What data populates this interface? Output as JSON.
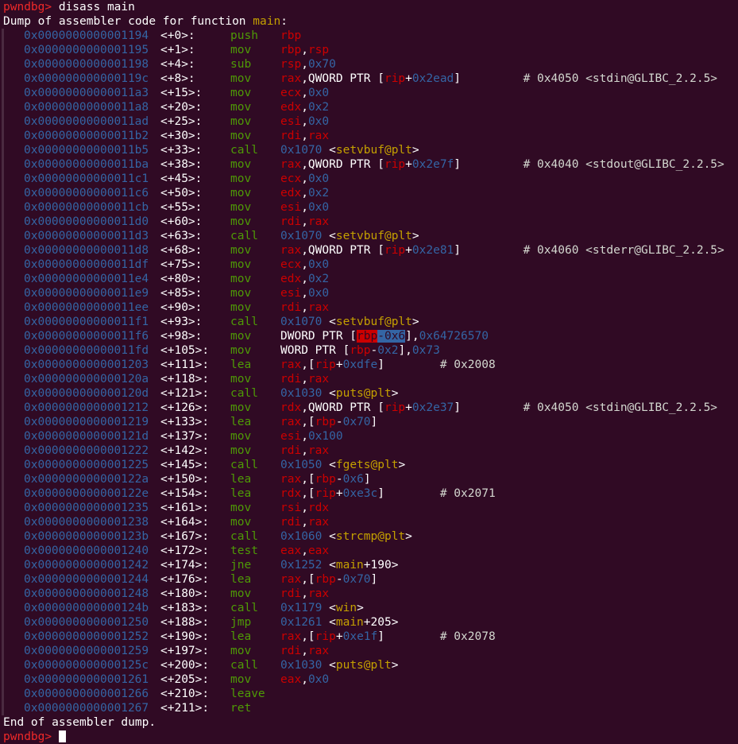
{
  "terminal": {
    "prompt": "pwndbg>",
    "command": " disass main",
    "header_prefix": "Dump of assembler code for function ",
    "function_name": "main",
    "header_suffix": ":",
    "footer": "End of assembler dump.",
    "next_prompt": "pwndbg>"
  },
  "instructions": [
    {
      "addr": "0x0000000000001194",
      "off": "<+0>:",
      "mn": "push",
      "ops": [
        [
          "reg",
          "rbp"
        ]
      ]
    },
    {
      "addr": "0x0000000000001195",
      "off": "<+1>:",
      "mn": "mov",
      "ops": [
        [
          "reg",
          "rbp"
        ],
        [
          "w",
          ","
        ],
        [
          "reg",
          "rsp"
        ]
      ]
    },
    {
      "addr": "0x0000000000001198",
      "off": "<+4>:",
      "mn": "sub",
      "ops": [
        [
          "reg",
          "rsp"
        ],
        [
          "w",
          ","
        ],
        [
          "num",
          "0x70"
        ]
      ]
    },
    {
      "addr": "0x000000000000119c",
      "off": "<+8>:",
      "mn": "mov",
      "ops": [
        [
          "reg",
          "rax"
        ],
        [
          "w",
          ",QWORD PTR ["
        ],
        [
          "reg",
          "rip"
        ],
        [
          "w",
          "+"
        ],
        [
          "num",
          "0x2ead"
        ],
        [
          "w",
          "]"
        ],
        [
          "cmt",
          "         # 0x4050 <stdin@GLIBC_2.2.5>"
        ]
      ]
    },
    {
      "addr": "0x00000000000011a3",
      "off": "<+15>:",
      "mn": "mov",
      "ops": [
        [
          "reg",
          "ecx"
        ],
        [
          "w",
          ","
        ],
        [
          "num",
          "0x0"
        ]
      ]
    },
    {
      "addr": "0x00000000000011a8",
      "off": "<+20>:",
      "mn": "mov",
      "ops": [
        [
          "reg",
          "edx"
        ],
        [
          "w",
          ","
        ],
        [
          "num",
          "0x2"
        ]
      ]
    },
    {
      "addr": "0x00000000000011ad",
      "off": "<+25>:",
      "mn": "mov",
      "ops": [
        [
          "reg",
          "esi"
        ],
        [
          "w",
          ","
        ],
        [
          "num",
          "0x0"
        ]
      ]
    },
    {
      "addr": "0x00000000000011b2",
      "off": "<+30>:",
      "mn": "mov",
      "ops": [
        [
          "reg",
          "rdi"
        ],
        [
          "w",
          ","
        ],
        [
          "reg",
          "rax"
        ]
      ]
    },
    {
      "addr": "0x00000000000011b5",
      "off": "<+33>:",
      "mn": "call",
      "ops": [
        [
          "num",
          "0x1070"
        ],
        [
          "w",
          " <"
        ],
        [
          "sym",
          "setvbuf@plt"
        ],
        [
          "w",
          ">"
        ]
      ]
    },
    {
      "addr": "0x00000000000011ba",
      "off": "<+38>:",
      "mn": "mov",
      "ops": [
        [
          "reg",
          "rax"
        ],
        [
          "w",
          ",QWORD PTR ["
        ],
        [
          "reg",
          "rip"
        ],
        [
          "w",
          "+"
        ],
        [
          "num",
          "0x2e7f"
        ],
        [
          "w",
          "]"
        ],
        [
          "cmt",
          "         # 0x4040 <stdout@GLIBC_2.2.5>"
        ]
      ]
    },
    {
      "addr": "0x00000000000011c1",
      "off": "<+45>:",
      "mn": "mov",
      "ops": [
        [
          "reg",
          "ecx"
        ],
        [
          "w",
          ","
        ],
        [
          "num",
          "0x0"
        ]
      ]
    },
    {
      "addr": "0x00000000000011c6",
      "off": "<+50>:",
      "mn": "mov",
      "ops": [
        [
          "reg",
          "edx"
        ],
        [
          "w",
          ","
        ],
        [
          "num",
          "0x2"
        ]
      ]
    },
    {
      "addr": "0x00000000000011cb",
      "off": "<+55>:",
      "mn": "mov",
      "ops": [
        [
          "reg",
          "esi"
        ],
        [
          "w",
          ","
        ],
        [
          "num",
          "0x0"
        ]
      ]
    },
    {
      "addr": "0x00000000000011d0",
      "off": "<+60>:",
      "mn": "mov",
      "ops": [
        [
          "reg",
          "rdi"
        ],
        [
          "w",
          ","
        ],
        [
          "reg",
          "rax"
        ]
      ]
    },
    {
      "addr": "0x00000000000011d3",
      "off": "<+63>:",
      "mn": "call",
      "ops": [
        [
          "num",
          "0x1070"
        ],
        [
          "w",
          " <"
        ],
        [
          "sym",
          "setvbuf@plt"
        ],
        [
          "w",
          ">"
        ]
      ]
    },
    {
      "addr": "0x00000000000011d8",
      "off": "<+68>:",
      "mn": "mov",
      "ops": [
        [
          "reg",
          "rax"
        ],
        [
          "w",
          ",QWORD PTR ["
        ],
        [
          "reg",
          "rip"
        ],
        [
          "w",
          "+"
        ],
        [
          "num",
          "0x2e81"
        ],
        [
          "w",
          "]"
        ],
        [
          "cmt",
          "         # 0x4060 <stderr@GLIBC_2.2.5>"
        ]
      ]
    },
    {
      "addr": "0x00000000000011df",
      "off": "<+75>:",
      "mn": "mov",
      "ops": [
        [
          "reg",
          "ecx"
        ],
        [
          "w",
          ","
        ],
        [
          "num",
          "0x0"
        ]
      ]
    },
    {
      "addr": "0x00000000000011e4",
      "off": "<+80>:",
      "mn": "mov",
      "ops": [
        [
          "reg",
          "edx"
        ],
        [
          "w",
          ","
        ],
        [
          "num",
          "0x2"
        ]
      ]
    },
    {
      "addr": "0x00000000000011e9",
      "off": "<+85>:",
      "mn": "mov",
      "ops": [
        [
          "reg",
          "esi"
        ],
        [
          "w",
          ","
        ],
        [
          "num",
          "0x0"
        ]
      ]
    },
    {
      "addr": "0x00000000000011ee",
      "off": "<+90>:",
      "mn": "mov",
      "ops": [
        [
          "reg",
          "rdi"
        ],
        [
          "w",
          ","
        ],
        [
          "reg",
          "rax"
        ]
      ]
    },
    {
      "addr": "0x00000000000011f1",
      "off": "<+93>:",
      "mn": "call",
      "ops": [
        [
          "num",
          "0x1070"
        ],
        [
          "w",
          " <"
        ],
        [
          "sym",
          "setvbuf@plt"
        ],
        [
          "w",
          ">"
        ]
      ]
    },
    {
      "addr": "0x00000000000011f6",
      "off": "<+98>:",
      "mn": "mov",
      "ops": [
        [
          "w",
          "DWORD PTR ["
        ],
        [
          "hlr",
          "rbp"
        ],
        [
          "hlb",
          "-0x6"
        ],
        [
          "w",
          "],"
        ],
        [
          "num",
          "0x64726570"
        ]
      ]
    },
    {
      "addr": "0x00000000000011fd",
      "off": "<+105>:",
      "mn": "mov",
      "ops": [
        [
          "w",
          "WORD PTR ["
        ],
        [
          "reg",
          "rbp"
        ],
        [
          "w",
          "-"
        ],
        [
          "num",
          "0x2"
        ],
        [
          "w",
          "],"
        ],
        [
          "num",
          "0x73"
        ]
      ]
    },
    {
      "addr": "0x0000000000001203",
      "off": "<+111>:",
      "mn": "lea",
      "ops": [
        [
          "reg",
          "rax"
        ],
        [
          "w",
          ",["
        ],
        [
          "reg",
          "rip"
        ],
        [
          "w",
          "+"
        ],
        [
          "num",
          "0xdfe"
        ],
        [
          "w",
          "]"
        ],
        [
          "cmt",
          "        # 0x2008"
        ]
      ]
    },
    {
      "addr": "0x000000000000120a",
      "off": "<+118>:",
      "mn": "mov",
      "ops": [
        [
          "reg",
          "rdi"
        ],
        [
          "w",
          ","
        ],
        [
          "reg",
          "rax"
        ]
      ]
    },
    {
      "addr": "0x000000000000120d",
      "off": "<+121>:",
      "mn": "call",
      "ops": [
        [
          "num",
          "0x1030"
        ],
        [
          "w",
          " <"
        ],
        [
          "sym",
          "puts@plt"
        ],
        [
          "w",
          ">"
        ]
      ]
    },
    {
      "addr": "0x0000000000001212",
      "off": "<+126>:",
      "mn": "mov",
      "ops": [
        [
          "reg",
          "rdx"
        ],
        [
          "w",
          ",QWORD PTR ["
        ],
        [
          "reg",
          "rip"
        ],
        [
          "w",
          "+"
        ],
        [
          "num",
          "0x2e37"
        ],
        [
          "w",
          "]"
        ],
        [
          "cmt",
          "         # 0x4050 <stdin@GLIBC_2.2.5>"
        ]
      ]
    },
    {
      "addr": "0x0000000000001219",
      "off": "<+133>:",
      "mn": "lea",
      "ops": [
        [
          "reg",
          "rax"
        ],
        [
          "w",
          ",["
        ],
        [
          "reg",
          "rbp"
        ],
        [
          "w",
          "-"
        ],
        [
          "num",
          "0x70"
        ],
        [
          "w",
          "]"
        ]
      ]
    },
    {
      "addr": "0x000000000000121d",
      "off": "<+137>:",
      "mn": "mov",
      "ops": [
        [
          "reg",
          "esi"
        ],
        [
          "w",
          ","
        ],
        [
          "num",
          "0x100"
        ]
      ]
    },
    {
      "addr": "0x0000000000001222",
      "off": "<+142>:",
      "mn": "mov",
      "ops": [
        [
          "reg",
          "rdi"
        ],
        [
          "w",
          ","
        ],
        [
          "reg",
          "rax"
        ]
      ]
    },
    {
      "addr": "0x0000000000001225",
      "off": "<+145>:",
      "mn": "call",
      "ops": [
        [
          "num",
          "0x1050"
        ],
        [
          "w",
          " <"
        ],
        [
          "sym",
          "fgets@plt"
        ],
        [
          "w",
          ">"
        ]
      ]
    },
    {
      "addr": "0x000000000000122a",
      "off": "<+150>:",
      "mn": "lea",
      "ops": [
        [
          "reg",
          "rax"
        ],
        [
          "w",
          ",["
        ],
        [
          "reg",
          "rbp"
        ],
        [
          "w",
          "-"
        ],
        [
          "num",
          "0x6"
        ],
        [
          "w",
          "]"
        ]
      ]
    },
    {
      "addr": "0x000000000000122e",
      "off": "<+154>:",
      "mn": "lea",
      "ops": [
        [
          "reg",
          "rdx"
        ],
        [
          "w",
          ",["
        ],
        [
          "reg",
          "rip"
        ],
        [
          "w",
          "+"
        ],
        [
          "num",
          "0xe3c"
        ],
        [
          "w",
          "]"
        ],
        [
          "cmt",
          "        # 0x2071"
        ]
      ]
    },
    {
      "addr": "0x0000000000001235",
      "off": "<+161>:",
      "mn": "mov",
      "ops": [
        [
          "reg",
          "rsi"
        ],
        [
          "w",
          ","
        ],
        [
          "reg",
          "rdx"
        ]
      ]
    },
    {
      "addr": "0x0000000000001238",
      "off": "<+164>:",
      "mn": "mov",
      "ops": [
        [
          "reg",
          "rdi"
        ],
        [
          "w",
          ","
        ],
        [
          "reg",
          "rax"
        ]
      ]
    },
    {
      "addr": "0x000000000000123b",
      "off": "<+167>:",
      "mn": "call",
      "ops": [
        [
          "num",
          "0x1060"
        ],
        [
          "w",
          " <"
        ],
        [
          "sym",
          "strcmp@plt"
        ],
        [
          "w",
          ">"
        ]
      ]
    },
    {
      "addr": "0x0000000000001240",
      "off": "<+172>:",
      "mn": "test",
      "ops": [
        [
          "reg",
          "eax"
        ],
        [
          "w",
          ","
        ],
        [
          "reg",
          "eax"
        ]
      ]
    },
    {
      "addr": "0x0000000000001242",
      "off": "<+174>:",
      "mn": "jne",
      "ops": [
        [
          "num",
          "0x1252"
        ],
        [
          "w",
          " <"
        ],
        [
          "sym",
          "main"
        ],
        [
          "w",
          "+190>"
        ]
      ]
    },
    {
      "addr": "0x0000000000001244",
      "off": "<+176>:",
      "mn": "lea",
      "ops": [
        [
          "reg",
          "rax"
        ],
        [
          "w",
          ",["
        ],
        [
          "reg",
          "rbp"
        ],
        [
          "w",
          "-"
        ],
        [
          "num",
          "0x70"
        ],
        [
          "w",
          "]"
        ]
      ]
    },
    {
      "addr": "0x0000000000001248",
      "off": "<+180>:",
      "mn": "mov",
      "ops": [
        [
          "reg",
          "rdi"
        ],
        [
          "w",
          ","
        ],
        [
          "reg",
          "rax"
        ]
      ]
    },
    {
      "addr": "0x000000000000124b",
      "off": "<+183>:",
      "mn": "call",
      "ops": [
        [
          "num",
          "0x1179"
        ],
        [
          "w",
          " <"
        ],
        [
          "sym",
          "win"
        ],
        [
          "w",
          ">"
        ]
      ]
    },
    {
      "addr": "0x0000000000001250",
      "off": "<+188>:",
      "mn": "jmp",
      "ops": [
        [
          "num",
          "0x1261"
        ],
        [
          "w",
          " <"
        ],
        [
          "sym",
          "main"
        ],
        [
          "w",
          "+205>"
        ]
      ]
    },
    {
      "addr": "0x0000000000001252",
      "off": "<+190>:",
      "mn": "lea",
      "ops": [
        [
          "reg",
          "rax"
        ],
        [
          "w",
          ",["
        ],
        [
          "reg",
          "rip"
        ],
        [
          "w",
          "+"
        ],
        [
          "num",
          "0xe1f"
        ],
        [
          "w",
          "]"
        ],
        [
          "cmt",
          "        # 0x2078"
        ]
      ]
    },
    {
      "addr": "0x0000000000001259",
      "off": "<+197>:",
      "mn": "mov",
      "ops": [
        [
          "reg",
          "rdi"
        ],
        [
          "w",
          ","
        ],
        [
          "reg",
          "rax"
        ]
      ]
    },
    {
      "addr": "0x000000000000125c",
      "off": "<+200>:",
      "mn": "call",
      "ops": [
        [
          "num",
          "0x1030"
        ],
        [
          "w",
          " <"
        ],
        [
          "sym",
          "puts@plt"
        ],
        [
          "w",
          ">"
        ]
      ]
    },
    {
      "addr": "0x0000000000001261",
      "off": "<+205>:",
      "mn": "mov",
      "ops": [
        [
          "reg",
          "eax"
        ],
        [
          "w",
          ","
        ],
        [
          "num",
          "0x0"
        ]
      ]
    },
    {
      "addr": "0x0000000000001266",
      "off": "<+210>:",
      "mn": "leave",
      "ops": []
    },
    {
      "addr": "0x0000000000001267",
      "off": "<+211>:",
      "mn": "ret",
      "ops": []
    }
  ],
  "colors": {
    "background": "#300a24",
    "address": "#3465a4",
    "mnemonic": "#4e9a06",
    "register": "#cc0000",
    "symbol": "#c4a000",
    "prompt": "#ef2929"
  }
}
